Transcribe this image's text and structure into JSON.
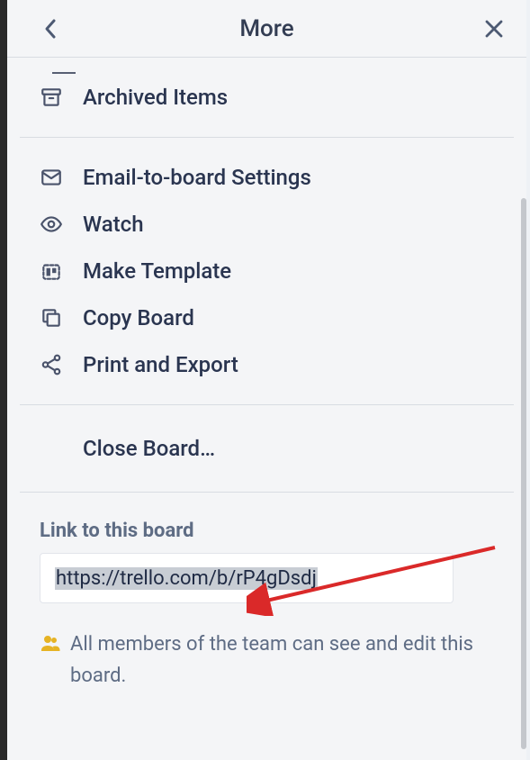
{
  "header": {
    "title": "More"
  },
  "menu": {
    "archived": "Archived Items",
    "email": "Email-to-board Settings",
    "watch": "Watch",
    "template": "Make Template",
    "copy": "Copy Board",
    "print": "Print and Export",
    "close": "Close Board…"
  },
  "link": {
    "label": "Link to this board",
    "url": "https://trello.com/b/rP4gDsdj"
  },
  "permission": {
    "text": "All members of the team can see and edit this board."
  },
  "colors": {
    "accent": "#da2929",
    "team_icon": "#e6b324"
  }
}
